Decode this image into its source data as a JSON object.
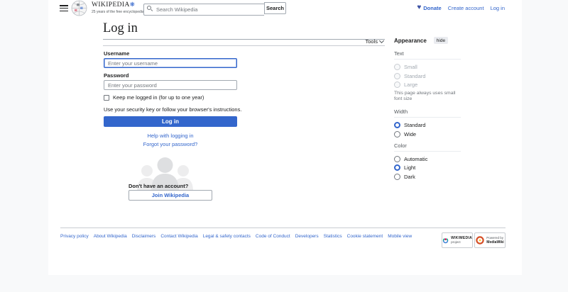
{
  "header": {
    "logo": {
      "wordmark": "WIKIPEDIA",
      "anniversary_mark": "❋",
      "tagline": "25 years of the free encyclopedia"
    },
    "search": {
      "placeholder": "Search Wikipedia",
      "button_label": "Search"
    },
    "links": {
      "donate": "Donate",
      "donate_icon": "♥",
      "create_account": "Create account",
      "log_in": "Log in"
    }
  },
  "main": {
    "title": "Log in",
    "tools_label": "Tools"
  },
  "form": {
    "username_label": "Username",
    "username_placeholder": "Enter your username",
    "password_label": "Password",
    "password_placeholder": "Enter your password",
    "keep_logged_in_label": "Keep me logged in (for up to one year)",
    "security_key_note": "Use your security key or follow your browser's instructions.",
    "login_button": "Log in",
    "help_link": "Help with logging in",
    "forgot_link": "Forgot your password?",
    "no_account_text": "Don't have an account?",
    "join_button": "Join Wikipedia"
  },
  "appearance": {
    "title": "Appearance",
    "hide_button": "hide",
    "text_section": {
      "label": "Text",
      "options": [
        {
          "label": "Small",
          "selected": false,
          "disabled": true
        },
        {
          "label": "Standard",
          "selected": false,
          "disabled": true
        },
        {
          "label": "Large",
          "selected": false,
          "disabled": true
        }
      ],
      "note": "This page always uses small font size"
    },
    "width_section": {
      "label": "Width",
      "options": [
        {
          "label": "Standard",
          "selected": true,
          "disabled": false
        },
        {
          "label": "Wide",
          "selected": false,
          "disabled": false
        }
      ]
    },
    "color_section": {
      "label": "Color",
      "options": [
        {
          "label": "Automatic",
          "selected": false,
          "disabled": false
        },
        {
          "label": "Light",
          "selected": true,
          "disabled": false
        },
        {
          "label": "Dark",
          "selected": false,
          "disabled": false
        }
      ]
    }
  },
  "footer": {
    "links": [
      "Privacy policy",
      "About Wikipedia",
      "Disclaimers",
      "Contact Wikipedia",
      "Legal & safety contacts",
      "Code of Conduct",
      "Developers",
      "Statistics",
      "Cookie statement",
      "Mobile view"
    ],
    "badges": {
      "wikimedia": {
        "line1": "WIKIMEDIA",
        "line2": "project"
      },
      "mediawiki": {
        "line1": "Powered by",
        "line2": "MediaWiki"
      }
    }
  },
  "colors": {
    "link_blue": "#3366cc",
    "progressive_button": "#3366cc",
    "page_background": "#f8f9fa",
    "border_gray": "#a2a9b1"
  }
}
